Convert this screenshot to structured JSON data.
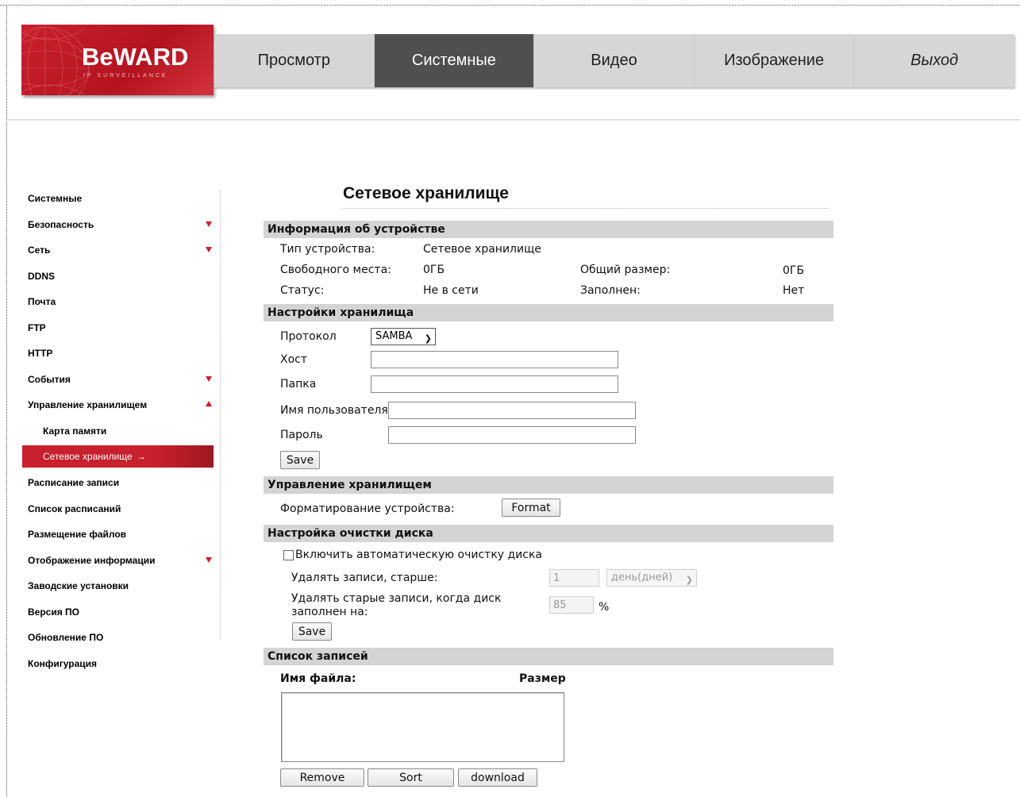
{
  "logo": {
    "word": "BeWARD",
    "subtitle": "IP SURVEILLANCE"
  },
  "nav": [
    {
      "label": "Просмотр",
      "active": false
    },
    {
      "label": "Системные",
      "active": true
    },
    {
      "label": "Видео",
      "active": false
    },
    {
      "label": "Изображение",
      "active": false
    },
    {
      "label": "Выход",
      "active": false
    }
  ],
  "sidebar": {
    "items": [
      {
        "label": "Системные"
      },
      {
        "label": "Безопасность",
        "expand": "down"
      },
      {
        "label": "Сеть",
        "expand": "down"
      },
      {
        "label": "DDNS"
      },
      {
        "label": "Почта"
      },
      {
        "label": "FTP"
      },
      {
        "label": "HTTP"
      },
      {
        "label": "События",
        "expand": "down"
      },
      {
        "label": "Управление хранилищем",
        "expand": "up"
      },
      {
        "label": "Карта памяти",
        "sub": true
      },
      {
        "label": "Сетевое хранилище",
        "sub": true,
        "active": true,
        "arrow": "→"
      },
      {
        "label": "Расписание записи"
      },
      {
        "label": "Список расписаний"
      },
      {
        "label": "Размещение файлов"
      },
      {
        "label": "Отображение информации",
        "expand": "down"
      },
      {
        "label": "Заводские установки"
      },
      {
        "label": "Версия ПО"
      },
      {
        "label": "Обновление ПО"
      },
      {
        "label": "Конфигурация"
      }
    ],
    "accent_color": "#c8202c"
  },
  "page": {
    "title": "Сетевое хранилище"
  },
  "device_info": {
    "header": "Информация об устройстве",
    "type_label": "Тип устройства:",
    "type_value": "Сетевое хранилище",
    "free_label": "Свободного места:",
    "free_value": "0ГБ",
    "total_label": "Общий размер:",
    "total_value": "0ГБ",
    "status_label": "Статус:",
    "status_value": "Не в сети",
    "full_label": "Заполнен:",
    "full_value": "Нет"
  },
  "storage_settings": {
    "header": "Настройки хранилища",
    "protocol_label": "Протокол",
    "protocol_value": "SAMBA",
    "host_label": "Хост",
    "host_value": "",
    "folder_label": "Папка",
    "folder_value": "",
    "user_label": "Имя пользователя",
    "user_value": "",
    "password_label": "Пароль",
    "password_value": "",
    "save_label": "Save"
  },
  "storage_management": {
    "header": "Управление хранилищем",
    "format_label": "Форматирование устройства:",
    "format_button": "Format"
  },
  "disk_cleanup": {
    "header": "Настройка очистки диска",
    "enable_label": "Включить автоматическую очистку диска",
    "enabled": false,
    "older_label": "Удалять записи, старше:",
    "older_value": "1",
    "older_unit": "день(дней)",
    "full_label_line1": "Удалять старые записи, когда диск",
    "full_label_line2": "заполнен на:",
    "full_value": "85",
    "full_unit": "%",
    "save_label": "Save"
  },
  "records": {
    "header": "Список записей",
    "col_filename": "Имя файла:",
    "col_size": "Размер",
    "remove_label": "Remove",
    "sort_label": "Sort",
    "download_label": "download"
  }
}
